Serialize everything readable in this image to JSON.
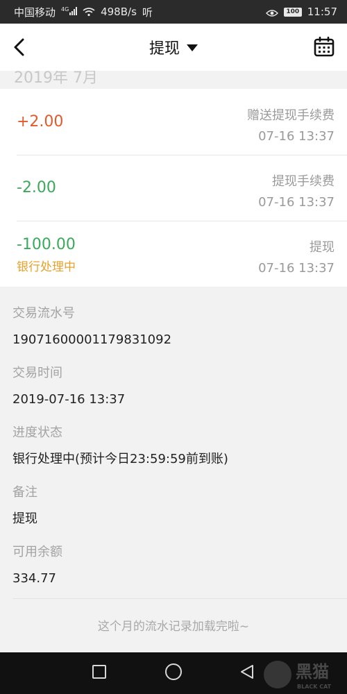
{
  "status_bar": {
    "carrier": "中国移动",
    "network": "4G",
    "speed": "498B/s",
    "extra": "听",
    "battery": "100",
    "time": "11:57"
  },
  "header": {
    "title": "提现",
    "back_icon": "chevron-left-icon",
    "dropdown_icon": "caret-down-icon",
    "calendar_icon": "calendar-icon"
  },
  "month_label": "2019年 7月",
  "colors": {
    "positive": "#e05a2b",
    "negative": "#3ba95a",
    "processing": "#e6a12b",
    "muted": "#9a9a9a"
  },
  "transactions": [
    {
      "amount": "+2.00",
      "status": "",
      "name": "赠送提现手续费",
      "time": "07-16 13:37"
    },
    {
      "amount": "-2.00",
      "status": "",
      "name": "提现手续费",
      "time": "07-16 13:37"
    },
    {
      "amount": "-100.00",
      "status": "银行处理中",
      "name": "提现",
      "time": "07-16 13:37"
    }
  ],
  "details": [
    {
      "label": "交易流水号",
      "value": "19071600001179831092"
    },
    {
      "label": "交易时间",
      "value": "2019-07-16 13:37"
    },
    {
      "label": "进度状态",
      "value": "银行处理中(预计今日23:59:59前到账)"
    },
    {
      "label": "备注",
      "value": "提现"
    },
    {
      "label": "可用余额",
      "value": "334.77"
    }
  ],
  "end_note": "这个月的流水记录加载完啦~",
  "watermark": "黑猫"
}
